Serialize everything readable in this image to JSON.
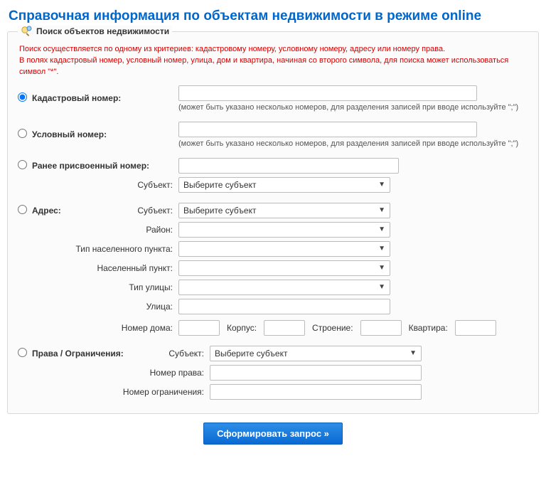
{
  "title": "Справочная информация по объектам недвижимости в режиме online",
  "fieldset_legend": "Поиск объектов недвижимости",
  "hint_line1": "Поиск осуществляется по одному из критериев: кадастровому номеру, условному номеру, адресу или номеру права.",
  "hint_line2": "В полях кадастровый номер, условный номер, улица, дом и квартира, начиная со второго символа, для поиска может использоваться символ \"*\".",
  "multi_note": "(может быть указано несколько номеров, для разделения записей при вводе используйте \";\")",
  "select_placeholder": "Выберите субъект",
  "sections": {
    "cadastral": {
      "label": "Кадастровый номер:"
    },
    "conditional": {
      "label": "Условный номер:"
    },
    "previous": {
      "label": "Ранее присвоенный номер:",
      "subject_label": "Субъект:"
    },
    "address": {
      "label": "Адрес:",
      "subject": "Субъект:",
      "district": "Район:",
      "settlement_type": "Тип населенного пункта:",
      "settlement": "Населенный пункт:",
      "street_type": "Тип улицы:",
      "street": "Улица:",
      "house": "Номер дома:",
      "building": "Корпус:",
      "structure": "Строение:",
      "flat": "Квартира:"
    },
    "rights": {
      "label": "Права / Ограничения:",
      "subject": "Субъект:",
      "right_no": "Номер права:",
      "restriction_no": "Номер ограничения:"
    }
  },
  "submit_label": "Сформировать запрос »",
  "selected_section": "cadastral"
}
